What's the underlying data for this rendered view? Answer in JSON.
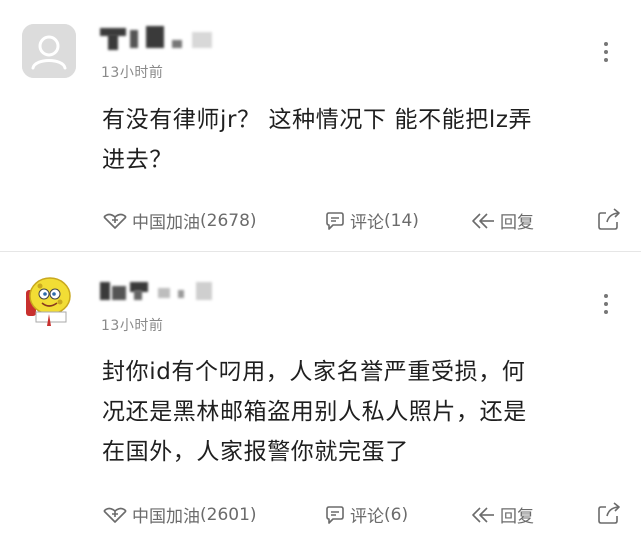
{
  "comments": [
    {
      "time": "13小时前",
      "text_line1": "有没有律师jr？ 这种情况下 能不能把lz弄",
      "text_line2": "进去？",
      "support_label": "中国加油",
      "support_count": "(2678)",
      "comment_label": "评论",
      "comment_count": "(14)",
      "reply_label": "回复",
      "avatar_icon": "default-user-avatar",
      "username_blurred": true
    },
    {
      "time": "13小时前",
      "text_line1": "封你id有个叼用，人家名誉严重受损，何",
      "text_line2": "况还是黑林邮箱盗用别人私人照片，还是",
      "text_line3": "在国外，人家报警你就完蛋了",
      "support_label": "中国加油",
      "support_count": "(2601)",
      "comment_label": "评论",
      "comment_count": "(6)",
      "reply_label": "回复",
      "avatar_icon": "cartoon-sponge-avatar",
      "username_blurred": true
    }
  ],
  "icons": {
    "support": "heart-plus-icon",
    "comment": "comment-bubble-icon",
    "reply": "reply-arrow-icon",
    "share": "share-icon",
    "more": "more-vertical-icon"
  },
  "colors": {
    "text": "#1f1f1f",
    "meta": "#8a8a8a",
    "action": "#6b6b6b",
    "divider": "#e6e6e6"
  }
}
